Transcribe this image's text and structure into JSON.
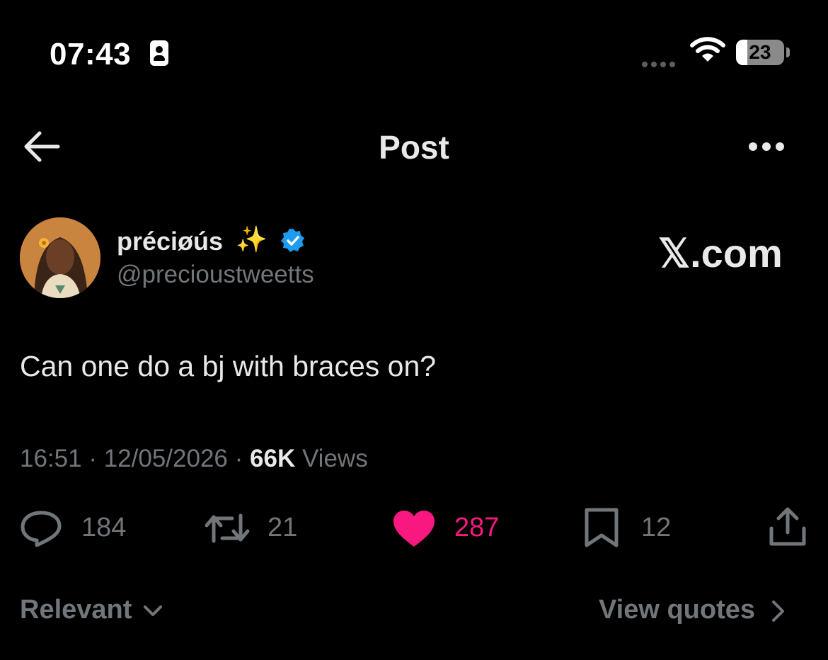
{
  "status_bar": {
    "time": "07:43",
    "battery": "23"
  },
  "header": {
    "title": "Post"
  },
  "author": {
    "name": "préciøús",
    "emoji": "✨",
    "handle": "@precioustweetts"
  },
  "watermark": "𝕏.com",
  "tweet": {
    "text": "Can one do a bj with braces on?"
  },
  "meta": {
    "time": "16:51",
    "sep": "·",
    "date": "12/05/2026",
    "views_count": "66K",
    "views_label": "Views"
  },
  "actions": {
    "replies": "184",
    "reposts": "21",
    "likes": "287",
    "bookmarks": "12"
  },
  "colors": {
    "like": "#f91880",
    "verified": "#1d9bf0",
    "muted": "#71767b"
  },
  "footer": {
    "sort": "Relevant",
    "quotes": "View quotes"
  }
}
